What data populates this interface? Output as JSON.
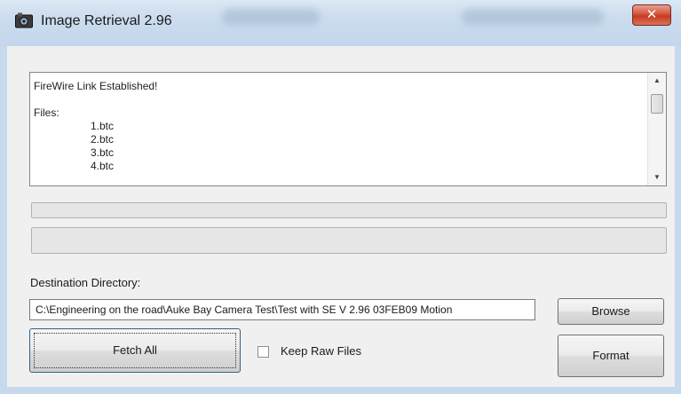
{
  "window": {
    "title": "Image Retrieval 2.96",
    "close_symbol": "✕",
    "app_icon": "camera-icon"
  },
  "log": {
    "lines": [
      "FireWire Link Established!",
      "Files:"
    ],
    "files": [
      "1.btc",
      "2.btc",
      "3.btc",
      "4.btc"
    ],
    "scroll_up_symbol": "▲",
    "scroll_down_symbol": "▼"
  },
  "progress": {
    "bar1_fraction": 0,
    "bar2_fraction": 0
  },
  "destination": {
    "label": "Destination Directory:",
    "path": "C:\\Engineering on the road\\Auke Bay Camera Test\\Test with SE V 2.96 03FEB09 Motion"
  },
  "buttons": {
    "browse": "Browse",
    "fetch_all": "Fetch All",
    "format": "Format"
  },
  "options": {
    "keep_raw_label": "Keep Raw Files",
    "keep_raw_checked": false
  }
}
